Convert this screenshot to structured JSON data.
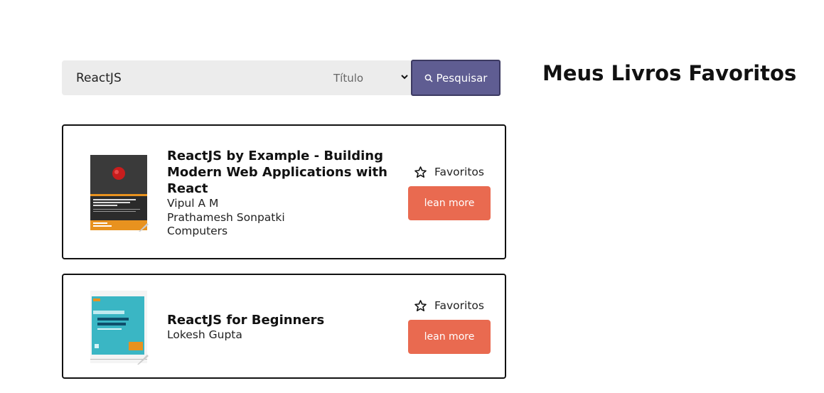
{
  "search": {
    "value": "ReactJS",
    "filter_selected": "Título",
    "button_label": "Pesquisar"
  },
  "favorites_heading": "Meus Livros Favoritos",
  "colors": {
    "search_button": "#5f5d92",
    "learn_button": "#e96a50",
    "input_bg": "#ececec"
  },
  "books": [
    {
      "title": "ReactJS by Example - Building Modern Web Applications with React",
      "authors": [
        "Vipul A M",
        "Prathamesh Sonpatki"
      ],
      "category": "Computers",
      "favorite_label": "Favoritos",
      "learn_more_label": "lean more"
    },
    {
      "title": "ReactJS for Beginners",
      "authors": [
        "Lokesh Gupta"
      ],
      "favorite_label": "Favoritos",
      "learn_more_label": "lean more"
    }
  ]
}
